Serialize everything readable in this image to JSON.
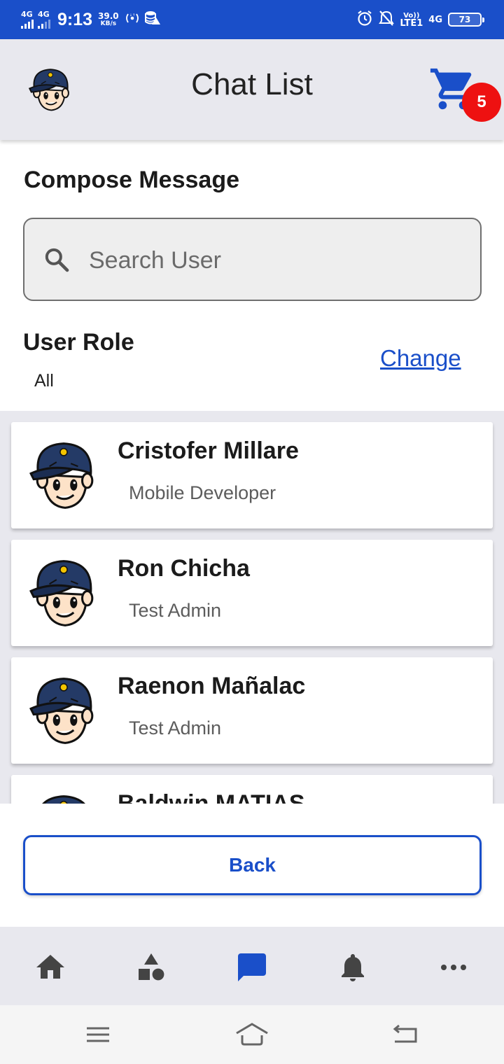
{
  "status_bar": {
    "signal1": "4G",
    "signal2": "4G",
    "time": "9:13",
    "speed_value": "39.0",
    "speed_unit": "KB/s",
    "volte": "Vo))",
    "lte": "LTE1",
    "net": "4G",
    "battery": "73"
  },
  "header": {
    "title": "Chat List",
    "cart_count": "5"
  },
  "compose": {
    "title": "Compose Message",
    "search_placeholder": "Search User",
    "search_value": ""
  },
  "role": {
    "label": "User Role",
    "value": "All",
    "change_label": "Change"
  },
  "users": [
    {
      "name": "Cristofer Millare",
      "role": "Mobile Developer"
    },
    {
      "name": "Ron Chicha",
      "role": "Test Admin"
    },
    {
      "name": "Raenon Mañalac",
      "role": "Test Admin"
    },
    {
      "name": "Baldwin MATIAS",
      "role": ""
    }
  ],
  "actions": {
    "back_label": "Back"
  },
  "bottom_nav": {
    "items": [
      {
        "icon": "home-icon",
        "active": false
      },
      {
        "icon": "shapes-icon",
        "active": false
      },
      {
        "icon": "chat-icon",
        "active": true
      },
      {
        "icon": "bell-icon",
        "active": false
      },
      {
        "icon": "more-icon",
        "active": false
      }
    ]
  },
  "colors": {
    "accent": "#1a4fc9",
    "badge": "#ee1111",
    "header_bg": "#e8e8ee"
  }
}
